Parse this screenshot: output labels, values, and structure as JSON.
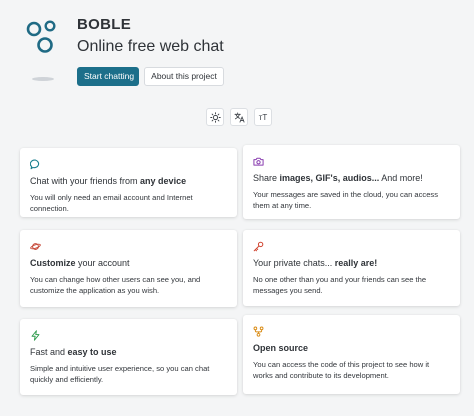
{
  "header": {
    "app_name": "BOBLE",
    "tagline": "Online free web chat",
    "start_label": "Start chatting",
    "about_label": "About this project"
  },
  "toolbar": {
    "theme_icon": "sun-icon",
    "translate_icon": "translate-icon",
    "font_size_label": "тT"
  },
  "colors": {
    "primary": "#1c6f8a",
    "logo": "#1f6a84",
    "icon_teal": "#1a7f8e",
    "icon_purple": "#8a3fb0",
    "icon_red": "#c64a3a",
    "icon_green": "#2c9a4a",
    "icon_orange": "#d98a12"
  },
  "features": [
    {
      "icon": "chat-icon",
      "title_pre": "Chat with your friends from ",
      "title_bold": "any device",
      "title_post": "",
      "desc": "You will only need an email account and Internet connection."
    },
    {
      "icon": "camera-icon",
      "title_pre": "Share ",
      "title_bold": "images, GIF's, audios...",
      "title_post": " And more!",
      "desc": "Your messages are saved in the cloud, you can access them at any time."
    },
    {
      "icon": "planet-icon",
      "title_pre": "",
      "title_bold": "Customize",
      "title_post": " your account",
      "desc": "You can change how other users can see you, and customize the application as you wish."
    },
    {
      "icon": "key-icon",
      "title_pre": "Your private chats... ",
      "title_bold": "really are!",
      "title_post": "",
      "desc": "No one other than you and your friends can see the messages you send."
    },
    {
      "icon": "lightning-icon",
      "title_pre": "Fast and ",
      "title_bold": "easy to use",
      "title_post": "",
      "desc": "Simple and intuitive user experience, so you can chat quickly and efficiently."
    },
    {
      "icon": "source-icon",
      "title_pre": "",
      "title_bold": "Open source",
      "title_post": "",
      "desc": "You can access the code of this project to see how it works and contribute to its development."
    }
  ]
}
